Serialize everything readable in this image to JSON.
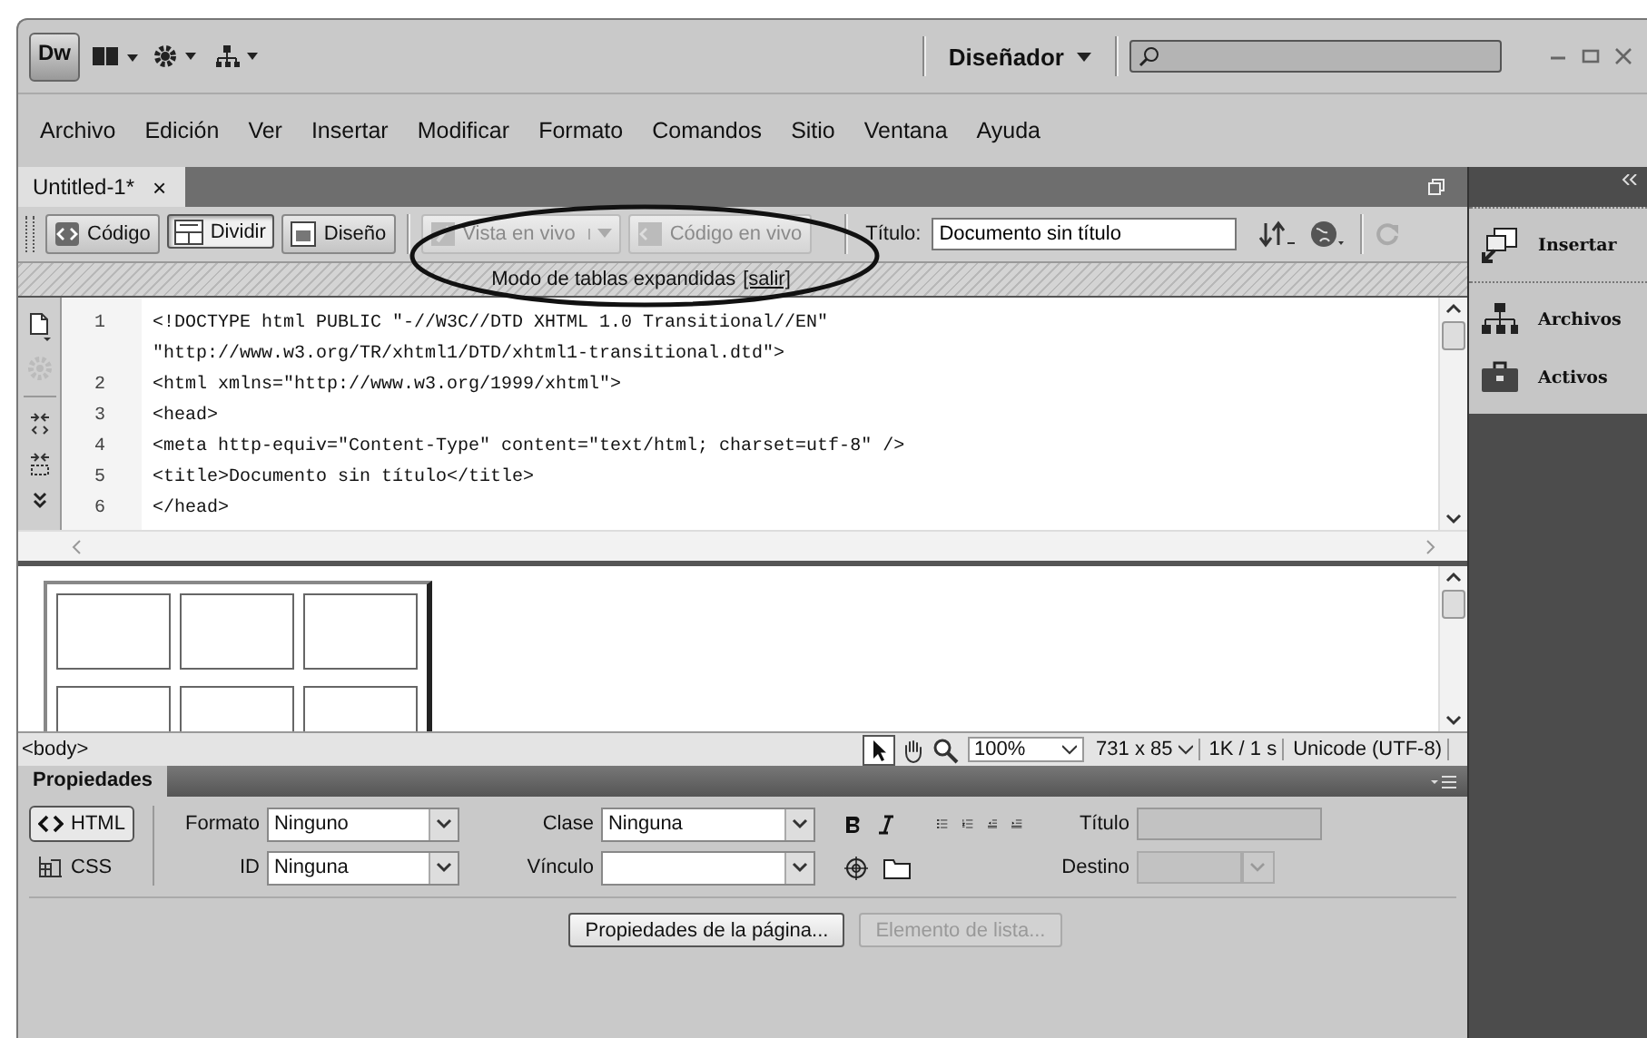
{
  "app_bar": {
    "logo": "Dw",
    "workspace": "Diseñador"
  },
  "menu": [
    "Archivo",
    "Edición",
    "Ver",
    "Insertar",
    "Modificar",
    "Formato",
    "Comandos",
    "Sitio",
    "Ventana",
    "Ayuda"
  ],
  "document_tab": {
    "label": "Untitled-1*",
    "close": "×"
  },
  "toolbar": {
    "view_buttons": [
      {
        "label": "Código",
        "kind": "code",
        "selected": false
      },
      {
        "label": "Dividir",
        "kind": "split",
        "selected": true
      },
      {
        "label": "Diseño",
        "kind": "design",
        "selected": false
      }
    ],
    "live_buttons": [
      {
        "label": "Vista en vivo",
        "kind": "view",
        "disabled": true
      },
      {
        "label": "Código en vivo",
        "kind": "code",
        "disabled": true
      }
    ],
    "title_label": "Título:",
    "title_value": "Documento sin título"
  },
  "mode_bar": {
    "text": "Modo de tablas expandidas",
    "link": "[salir]"
  },
  "code_lines": [
    {
      "number": "1",
      "text": "<!DOCTYPE html PUBLIC \"-//W3C//DTD XHTML 1.0 Transitional//EN\""
    },
    {
      "text": "\"http://www.w3.org/TR/xhtml1/DTD/xhtml1-transitional.dtd\">"
    },
    {
      "number": "2",
      "text": "<html xmlns=\"http://www.w3.org/1999/xhtml\">"
    },
    {
      "number": "3",
      "text": "<head>"
    },
    {
      "number": "4",
      "text": "<meta http-equiv=\"Content-Type\" content=\"text/html; charset=utf-8\" />"
    },
    {
      "number": "5",
      "text": "<title>Documento sin título</title>"
    },
    {
      "number": "6",
      "text": "</head>"
    }
  ],
  "status_bar": {
    "tag": "<body>",
    "zoom": "100%",
    "size": "731 x 85",
    "speed": "1K / 1 s",
    "encoding": "Unicode (UTF-8)"
  },
  "panels": [
    {
      "label": "Insertar",
      "kind": "insert"
    },
    {
      "label": "Archivos",
      "kind": "files"
    },
    {
      "label": "Activos",
      "kind": "assets"
    }
  ],
  "properties": {
    "title": "Propiedades",
    "modes": [
      {
        "label": "HTML",
        "kind": "html",
        "selected": true
      },
      {
        "label": "CSS",
        "kind": "css",
        "selected": false
      }
    ],
    "formato": {
      "label": "Formato",
      "value": "Ninguno"
    },
    "id": {
      "label": "ID",
      "value": "Ninguna"
    },
    "clase": {
      "label": "Clase",
      "value": "Ninguna"
    },
    "vinculo": {
      "label": "Vínculo"
    },
    "titulo": {
      "label": "Título",
      "disabled": true
    },
    "destino": {
      "label": "Destino",
      "disabled": true
    },
    "buttons": [
      {
        "label": "Propiedades de la página...",
        "disabled": false
      },
      {
        "label": "Elemento de lista...",
        "disabled": true
      }
    ]
  }
}
